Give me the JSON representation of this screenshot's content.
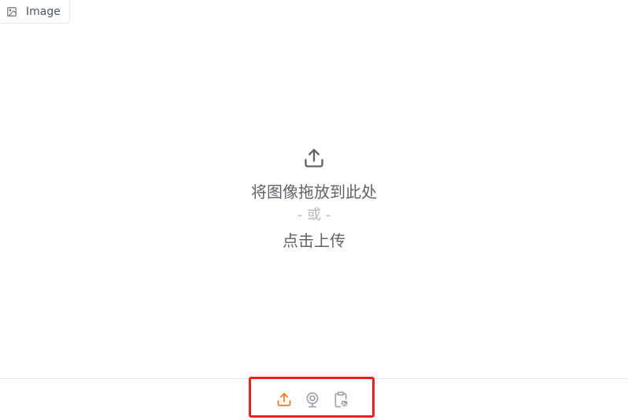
{
  "label_tab": {
    "icon": "image-icon",
    "text": "Image"
  },
  "drop_zone": {
    "icon": "upload-icon",
    "drop_text": "将图像拖放到此处",
    "or_text": "- 或 -",
    "click_text": "点击上传"
  },
  "sources": [
    {
      "name": "upload",
      "icon": "upload-icon",
      "active": true
    },
    {
      "name": "webcam",
      "icon": "webcam-icon",
      "active": false
    },
    {
      "name": "clipboard",
      "icon": "clipboard-icon",
      "active": false
    }
  ],
  "colors": {
    "active": "#f97316",
    "inactive": "#9ca3af",
    "highlight": "#ee1f1f",
    "text": "#5f6368",
    "muted": "#b4b8bd"
  }
}
